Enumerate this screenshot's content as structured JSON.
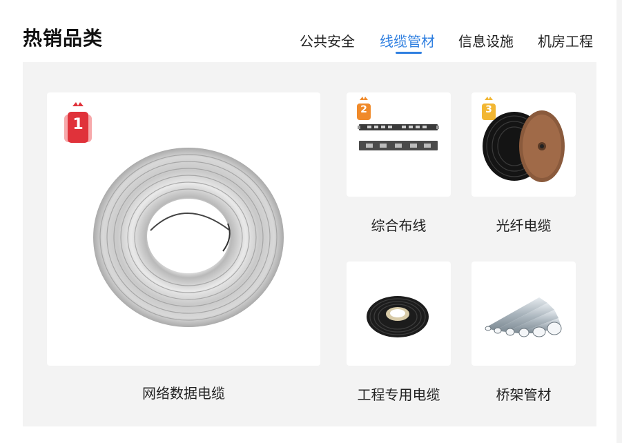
{
  "header": {
    "title": "热销品类"
  },
  "tabs": [
    {
      "label": "公共安全",
      "active": false
    },
    {
      "label": "线缆管材",
      "active": true
    },
    {
      "label": "信息设施",
      "active": false
    },
    {
      "label": "机房工程",
      "active": false
    }
  ],
  "colors": {
    "accent": "#2f7fe0",
    "rank1": "#e0323a",
    "rank2": "#f08a2a",
    "rank3": "#f2b632"
  },
  "products": [
    {
      "name": "网络数据电缆",
      "rank": "1",
      "icon": "network-cable-coil-image"
    },
    {
      "name": "综合布线",
      "rank": "2",
      "icon": "patch-panel-image"
    },
    {
      "name": "光纤电缆",
      "rank": "3",
      "icon": "fiber-cable-reel-image"
    },
    {
      "name": "工程专用电缆",
      "icon": "black-cable-coil-image"
    },
    {
      "name": "桥架管材",
      "icon": "steel-pipes-image"
    }
  ]
}
